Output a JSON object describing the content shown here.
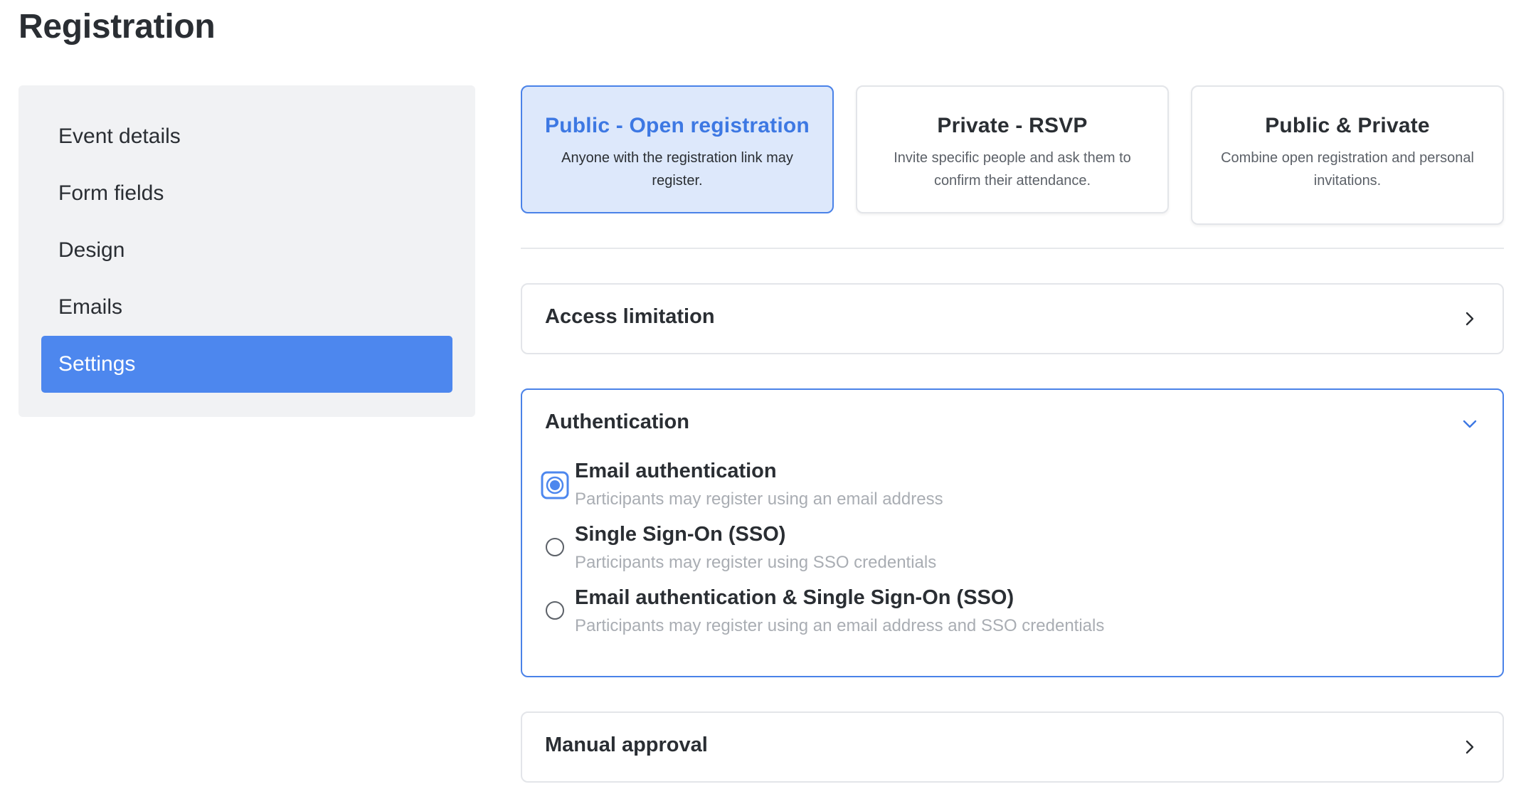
{
  "page": {
    "title": "Registration"
  },
  "sidebar": {
    "items": [
      {
        "label": "Event details",
        "active": false
      },
      {
        "label": "Form fields",
        "active": false
      },
      {
        "label": "Design",
        "active": false
      },
      {
        "label": "Emails",
        "active": false
      },
      {
        "label": "Settings",
        "active": true
      }
    ]
  },
  "registration_types": [
    {
      "title": "Public - Open registration",
      "description": "Anyone with the registration link may register.",
      "selected": true
    },
    {
      "title": "Private - RSVP",
      "description": "Invite specific people and ask them to confirm their attendance.",
      "selected": false
    },
    {
      "title": "Public & Private",
      "description": "Combine open registration and personal invitations.",
      "selected": false
    }
  ],
  "panels": {
    "access_limitation": {
      "title": "Access limitation",
      "expanded": false,
      "icon": "chevron-right-icon"
    },
    "authentication": {
      "title": "Authentication",
      "expanded": true,
      "icon": "chevron-down-icon",
      "options": [
        {
          "label": "Email authentication",
          "description": "Participants may register using an email address",
          "checked": true
        },
        {
          "label": "Single Sign-On (SSO)",
          "description": "Participants may register using SSO credentials",
          "checked": false
        },
        {
          "label": "Email authentication & Single Sign-On (SSO)",
          "description": "Participants may register using an email address and SSO credentials",
          "checked": false
        }
      ]
    },
    "manual_approval": {
      "title": "Manual approval",
      "expanded": false,
      "icon": "chevron-right-icon"
    }
  },
  "colors": {
    "accent": "#4d87ee",
    "selected_card_bg": "#dde8fb",
    "selected_card_border": "#4a82e8",
    "sidebar_bg": "#f1f2f4",
    "muted_text": "#a9adb3"
  }
}
